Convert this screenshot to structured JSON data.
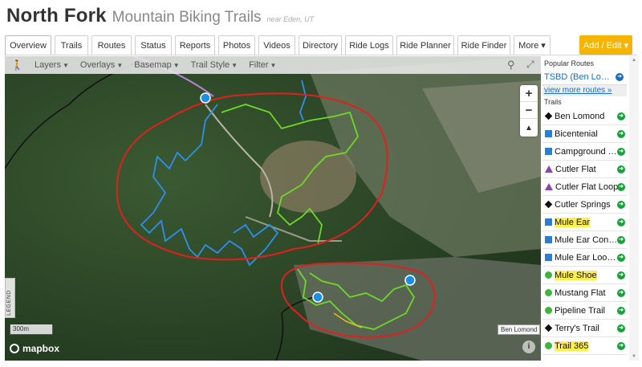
{
  "header": {
    "title": "North Fork",
    "subtitle": "Mountain Biking Trails",
    "location": "near Eden, UT"
  },
  "tabs": [
    {
      "label": "Overview",
      "active": true
    },
    {
      "label": "Trails"
    },
    {
      "label": "Routes"
    },
    {
      "label": "Status"
    },
    {
      "label": "Reports"
    },
    {
      "label": "Photos"
    },
    {
      "label": "Videos"
    },
    {
      "label": "Directory"
    },
    {
      "label": "Ride Logs"
    },
    {
      "label": "Ride Planner"
    },
    {
      "label": "Ride Finder"
    },
    {
      "label": "More ▾"
    }
  ],
  "add_edit_label": "Add / Edit ▾",
  "map": {
    "toolbar": {
      "layers": "Layers",
      "overlays": "Overlays",
      "basemap": "Basemap",
      "trail_style": "Trail Style",
      "filter": "Filter"
    },
    "legend_label": "LEGEND",
    "scale_label": "300m",
    "attribution": "mapbox",
    "peak_label": "Ben Lomond",
    "trail_name_label": "Cutler Flat"
  },
  "panel": {
    "popular_routes_heading": "Popular Routes",
    "popular_route": "TSBD (Ben Lomon...",
    "view_more": "view more routes »",
    "trails_heading": "Trails",
    "trails": [
      {
        "name": "Ben Lomond",
        "icon": "black-diamond",
        "color": "#111111"
      },
      {
        "name": "Bicentenial",
        "icon": "blue-square",
        "color": "#2a7fd4"
      },
      {
        "name": "Campground Sh...",
        "icon": "blue-square",
        "color": "#2a7fd4"
      },
      {
        "name": "Cutler Flat",
        "icon": "purple-triangle",
        "color": "#8e44ad"
      },
      {
        "name": "Cutler Flat Loop",
        "icon": "purple-triangle",
        "color": "#8e44ad"
      },
      {
        "name": "Cutler Springs",
        "icon": "black-diamond",
        "color": "#111111"
      },
      {
        "name": "Mule Ear",
        "icon": "blue-green-square",
        "color": "#2a7fd4",
        "highlighted": true
      },
      {
        "name": "Mule Ear Conne...",
        "icon": "blue-square",
        "color": "#2a7fd4"
      },
      {
        "name": "Mule Ear Lookout",
        "icon": "blue-square",
        "color": "#2a7fd4"
      },
      {
        "name": "Mule Shoe",
        "icon": "green-circle",
        "color": "#3cb53c",
        "highlighted": true
      },
      {
        "name": "Mustang Flat",
        "icon": "green-circle",
        "color": "#3cb53c"
      },
      {
        "name": "Pipeline Trail",
        "icon": "green-circle",
        "color": "#3cb53c"
      },
      {
        "name": "Terry's Trail",
        "icon": "black-diamond",
        "color": "#111111"
      },
      {
        "name": "Trail 365",
        "icon": "green-circle",
        "color": "#3cb53c",
        "highlighted": true
      }
    ]
  },
  "colors": {
    "accent": "#f4b400",
    "link": "#1a6ec0",
    "blue_trail": "#2f8ff0",
    "green_trail": "#6ed82a",
    "highlight_circle": "#e02020",
    "highlight_text": "#fff14a"
  }
}
